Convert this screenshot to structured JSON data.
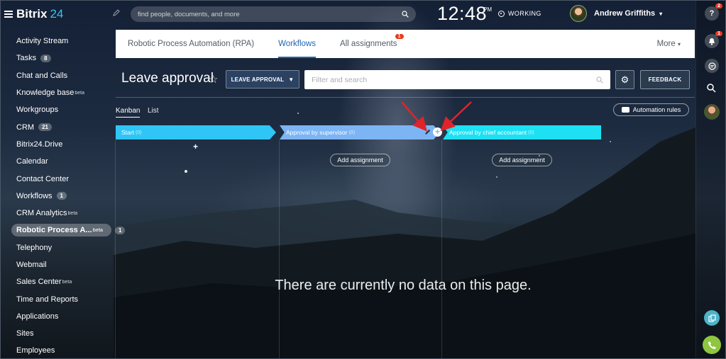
{
  "app": {
    "logo_name": "Bitrix",
    "logo_num": "24"
  },
  "header": {
    "search_placeholder": "find people, documents, and more",
    "time": "12:48",
    "time_suffix": "PM",
    "status": "WORKING",
    "user_name": "Andrew Griffiths"
  },
  "sidebar": {
    "items": [
      {
        "label": "Activity Stream"
      },
      {
        "label": "Tasks",
        "badge": "8"
      },
      {
        "label": "Chat and Calls"
      },
      {
        "label": "Knowledge base",
        "sup": "beta"
      },
      {
        "label": "Workgroups"
      },
      {
        "label": "CRM",
        "badge": "21"
      },
      {
        "label": "Bitrix24.Drive"
      },
      {
        "label": "Calendar"
      },
      {
        "label": "Contact Center"
      },
      {
        "label": "Workflows",
        "badge": "1"
      },
      {
        "label": "CRM Analytics",
        "sup": "beta"
      },
      {
        "label": "Robotic Process A...",
        "sup": "beta",
        "badge": "1"
      },
      {
        "label": "Telephony"
      },
      {
        "label": "Webmail"
      },
      {
        "label": "Sales Center",
        "sup": "beta"
      },
      {
        "label": "Time and Reports"
      },
      {
        "label": "Applications"
      },
      {
        "label": "Sites"
      },
      {
        "label": "Employees"
      }
    ]
  },
  "tabs": {
    "items": [
      {
        "label": "Robotic Process Automation (RPA)"
      },
      {
        "label": "Workflows"
      },
      {
        "label": "All assignments",
        "badge": "1"
      }
    ],
    "more": "More"
  },
  "toolbar": {
    "title": "Leave approval",
    "dropdown_label": "LEAVE APPROVAL",
    "filter_placeholder": "Filter and search",
    "feedback_label": "FEEDBACK",
    "view_kanban": "Kanban",
    "view_list": "List",
    "automation_rules": "Automation rules"
  },
  "kanban": {
    "stages": [
      {
        "name": "Start",
        "count": "(0)",
        "color": "#2fc6f6"
      },
      {
        "name": "Approval by supervisor",
        "count": "(0)",
        "color": "#7db5f4"
      },
      {
        "name": "Approval by chief accountant",
        "count": "(0)",
        "color": "#1ee0f3"
      }
    ],
    "add_assignment": "Add assignment",
    "empty_message": "There are currently no data on this page."
  },
  "rail": {
    "help_badge": "2",
    "notifications_badge": "1"
  },
  "colors": {
    "accent": "#2067b0",
    "badge": "#f0371b",
    "arrow": "#e0242a"
  }
}
